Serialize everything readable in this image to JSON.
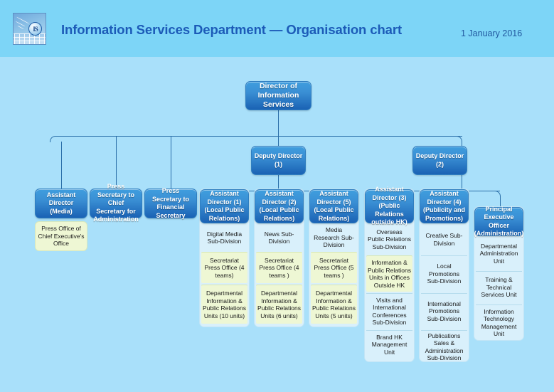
{
  "header": {
    "title": "Information Services Department — Organisation chart",
    "date": "1 January 2016",
    "logo_icon": "isd-logo-icon",
    "logo_monogram": "IS",
    "band_color": "#7dd5f7"
  },
  "theme": {
    "page_background": "#a9e0fa",
    "node_blue_top": "#3f9ede",
    "node_blue_bottom": "#1a62b4",
    "panel_background": "#d9f0fb",
    "green_cell": "#eef7d4",
    "connector": "#2a6ea8",
    "title_color": "#1c5bb8"
  },
  "chart": {
    "root": {
      "label": "Director of Information Services"
    },
    "deputies": [
      {
        "label": "Deputy Director (1)"
      },
      {
        "label": "Deputy Director (2)"
      }
    ],
    "left_branch": [
      {
        "label": "Assistant Director (Media)"
      },
      {
        "label": "Press Secretary to Chief Secretary for Administration"
      },
      {
        "label": "Press Secretary to Financial Secretary"
      }
    ],
    "media_leaf": {
      "label": "Press Office of Chief Executive's Office"
    },
    "columns": [
      {
        "head": "Assistant Director (1) (Local Public Relations)",
        "items": [
          {
            "label": "Digital Media Sub-Division",
            "style": "plain"
          },
          {
            "label": "Secretariat Press Office (4 teams)",
            "style": "green"
          },
          {
            "label": "Departmental Information & Public Relations Units (10 units)",
            "style": "green"
          }
        ]
      },
      {
        "head": "Assistant Director (2) (Local Public Relations)",
        "items": [
          {
            "label": "News Sub-Division",
            "style": "plain"
          },
          {
            "label": "Secretariat Press Office (4 teams )",
            "style": "green"
          },
          {
            "label": "Departmental Information & Public Relations Units (6 units)",
            "style": "green"
          }
        ]
      },
      {
        "head": "Assistant Director (5) (Local Public Relations)",
        "items": [
          {
            "label": "Media Research Sub-Division",
            "style": "plain"
          },
          {
            "label": "Secretariat Press Office (5 teams )",
            "style": "green"
          },
          {
            "label": "Departmental Information & Public Relations Units (5 units)",
            "style": "green"
          }
        ]
      },
      {
        "head": "Assistant Director (3) (Public Relations outside HK)",
        "items": [
          {
            "label": "Overseas Public Relations Sub-Division",
            "style": "plain"
          },
          {
            "label": "Information & Public Relations Units in Offices Outside HK",
            "style": "green"
          },
          {
            "label": "Visits and International Conferences Sub-Division",
            "style": "plain"
          },
          {
            "label": "Brand HK Management Unit",
            "style": "plain"
          }
        ]
      },
      {
        "head": "Assistant Director (4) (Publicity and Promotions)",
        "items": [
          {
            "label": "Creative Sub-Division",
            "style": "plain"
          },
          {
            "label": "Local Promotions Sub-Division",
            "style": "plain"
          },
          {
            "label": "International Promotions Sub-Division",
            "style": "plain"
          },
          {
            "label": "Publications Sales & Administration Sub-Division",
            "style": "plain"
          }
        ]
      },
      {
        "head": "Principal Executive Officer (Administration)",
        "items": [
          {
            "label": "Departmental Administration Unit",
            "style": "plain"
          },
          {
            "label": "Training & Technical Services Unit",
            "style": "plain"
          },
          {
            "label": "Information Technology Management Unit",
            "style": "plain"
          }
        ]
      }
    ]
  }
}
